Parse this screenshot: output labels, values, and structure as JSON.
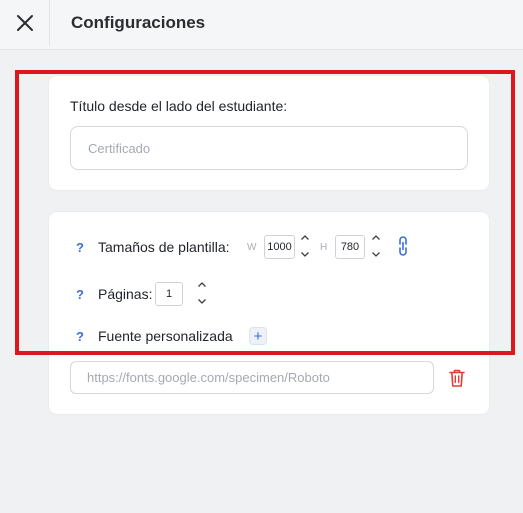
{
  "header": {
    "title": "Configuraciones",
    "close_icon": "close-icon"
  },
  "student_title": {
    "label": "Título desde el lado del estudiante:",
    "placeholder": "Certificado",
    "value": ""
  },
  "template": {
    "sizes": {
      "help": "?",
      "label": "Tamaños de plantilla:",
      "width_letter": "W",
      "width_value": "1000",
      "height_letter": "H",
      "height_value": "780",
      "link_icon": "link-icon"
    },
    "pages": {
      "help": "?",
      "label": "Páginas:",
      "value": "1"
    },
    "font": {
      "help": "?",
      "label": "Fuente personalizada",
      "add_label": "+",
      "url_placeholder": "https://fonts.google.com/specimen/Roboto",
      "delete_icon": "trash-icon"
    }
  },
  "colors": {
    "accent": "#3b6fd8",
    "highlight": "#e0161e",
    "delete": "#e53935"
  }
}
